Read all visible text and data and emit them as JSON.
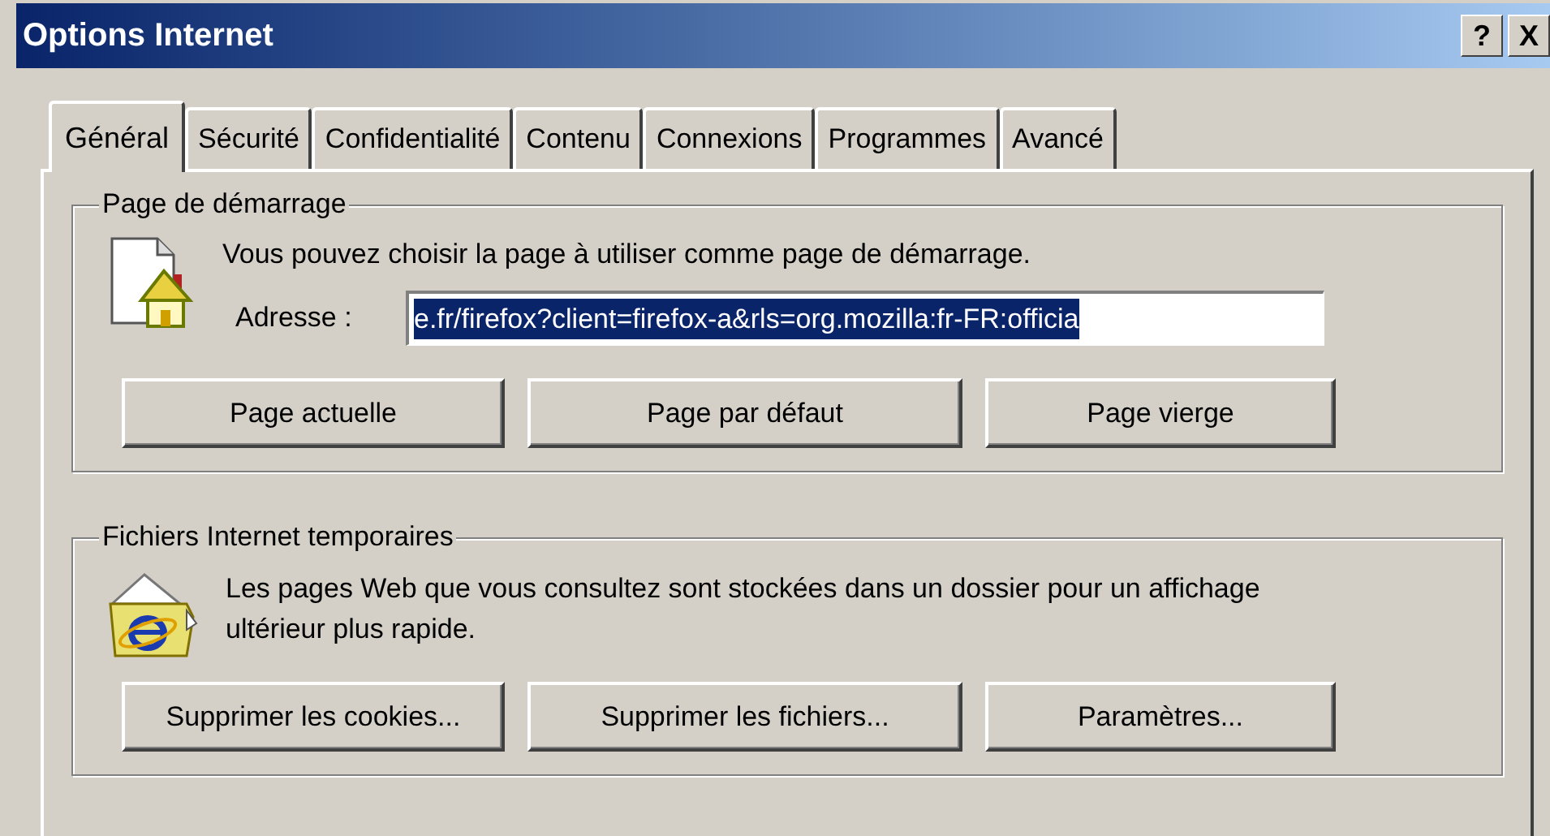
{
  "window": {
    "title": "Options Internet",
    "title_buttons": [
      "?",
      "X"
    ]
  },
  "tabs": [
    {
      "label": "Général",
      "selected": true
    },
    {
      "label": "Sécurité",
      "selected": false
    },
    {
      "label": "Confidentialité",
      "selected": false
    },
    {
      "label": "Contenu",
      "selected": false
    },
    {
      "label": "Connexions",
      "selected": false
    },
    {
      "label": "Programmes",
      "selected": false
    },
    {
      "label": "Avancé",
      "selected": false
    }
  ],
  "startup": {
    "title": "Page de démarrage",
    "description": "Vous pouvez choisir la page à utiliser comme page de démarrage.",
    "address_label": "Adresse :",
    "address_value": "e.fr/firefox?client=firefox-a&rls=org.mozilla:fr-FR:officia",
    "address_selected": true,
    "buttons": [
      "Page actuelle",
      "Page par défaut",
      "Page vierge"
    ]
  },
  "temp_files": {
    "title": "Fichiers Internet temporaires",
    "description": "Les pages Web que vous consultez sont stockées dans un dossier pour un affichage ultérieur plus rapide.",
    "buttons": [
      "Supprimer les cookies...",
      "Supprimer les fichiers...",
      "Paramètres..."
    ]
  }
}
